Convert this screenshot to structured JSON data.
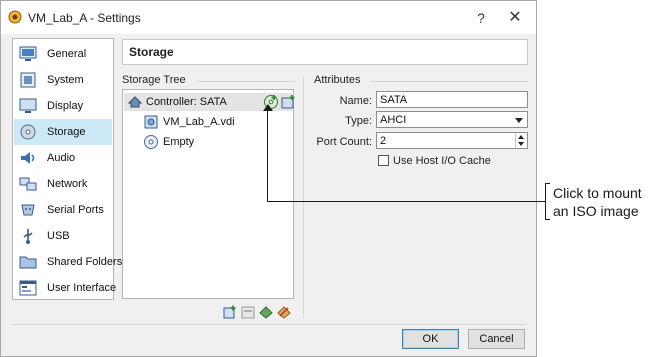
{
  "window": {
    "title": "VM_Lab_A - Settings",
    "help_label": "?",
    "close_label": "✕"
  },
  "sidebar": {
    "items": [
      {
        "label": "General",
        "icon": "general-icon"
      },
      {
        "label": "System",
        "icon": "system-icon"
      },
      {
        "label": "Display",
        "icon": "display-icon"
      },
      {
        "label": "Storage",
        "icon": "storage-icon",
        "selected": true
      },
      {
        "label": "Audio",
        "icon": "audio-icon"
      },
      {
        "label": "Network",
        "icon": "network-icon"
      },
      {
        "label": "Serial Ports",
        "icon": "serial-ports-icon"
      },
      {
        "label": "USB",
        "icon": "usb-icon"
      },
      {
        "label": "Shared Folders",
        "icon": "shared-folders-icon"
      },
      {
        "label": "User Interface",
        "icon": "user-interface-icon"
      }
    ]
  },
  "page": {
    "title": "Storage"
  },
  "storage_tree": {
    "label": "Storage Tree",
    "controller": "Controller: SATA",
    "items": [
      {
        "label": "VM_Lab_A.vdi",
        "icon": "hard-disk-icon"
      },
      {
        "label": "Empty",
        "icon": "optical-disc-icon"
      }
    ]
  },
  "attributes": {
    "label": "Attributes",
    "name_label": "Name:",
    "name_value": "SATA",
    "type_label": "Type:",
    "type_value": "AHCI",
    "port_count_label": "Port Count:",
    "port_count_value": "2",
    "host_cache_label": "Use Host I/O Cache",
    "host_cache_checked": false
  },
  "buttons": {
    "ok": "OK",
    "cancel": "Cancel"
  },
  "callout": {
    "line1": "Click to mount",
    "line2": "an ISO image"
  },
  "colors": {
    "selection": "#cde8f7",
    "accent": "#3c7fb1",
    "window_bg": "#f0f0f0"
  }
}
